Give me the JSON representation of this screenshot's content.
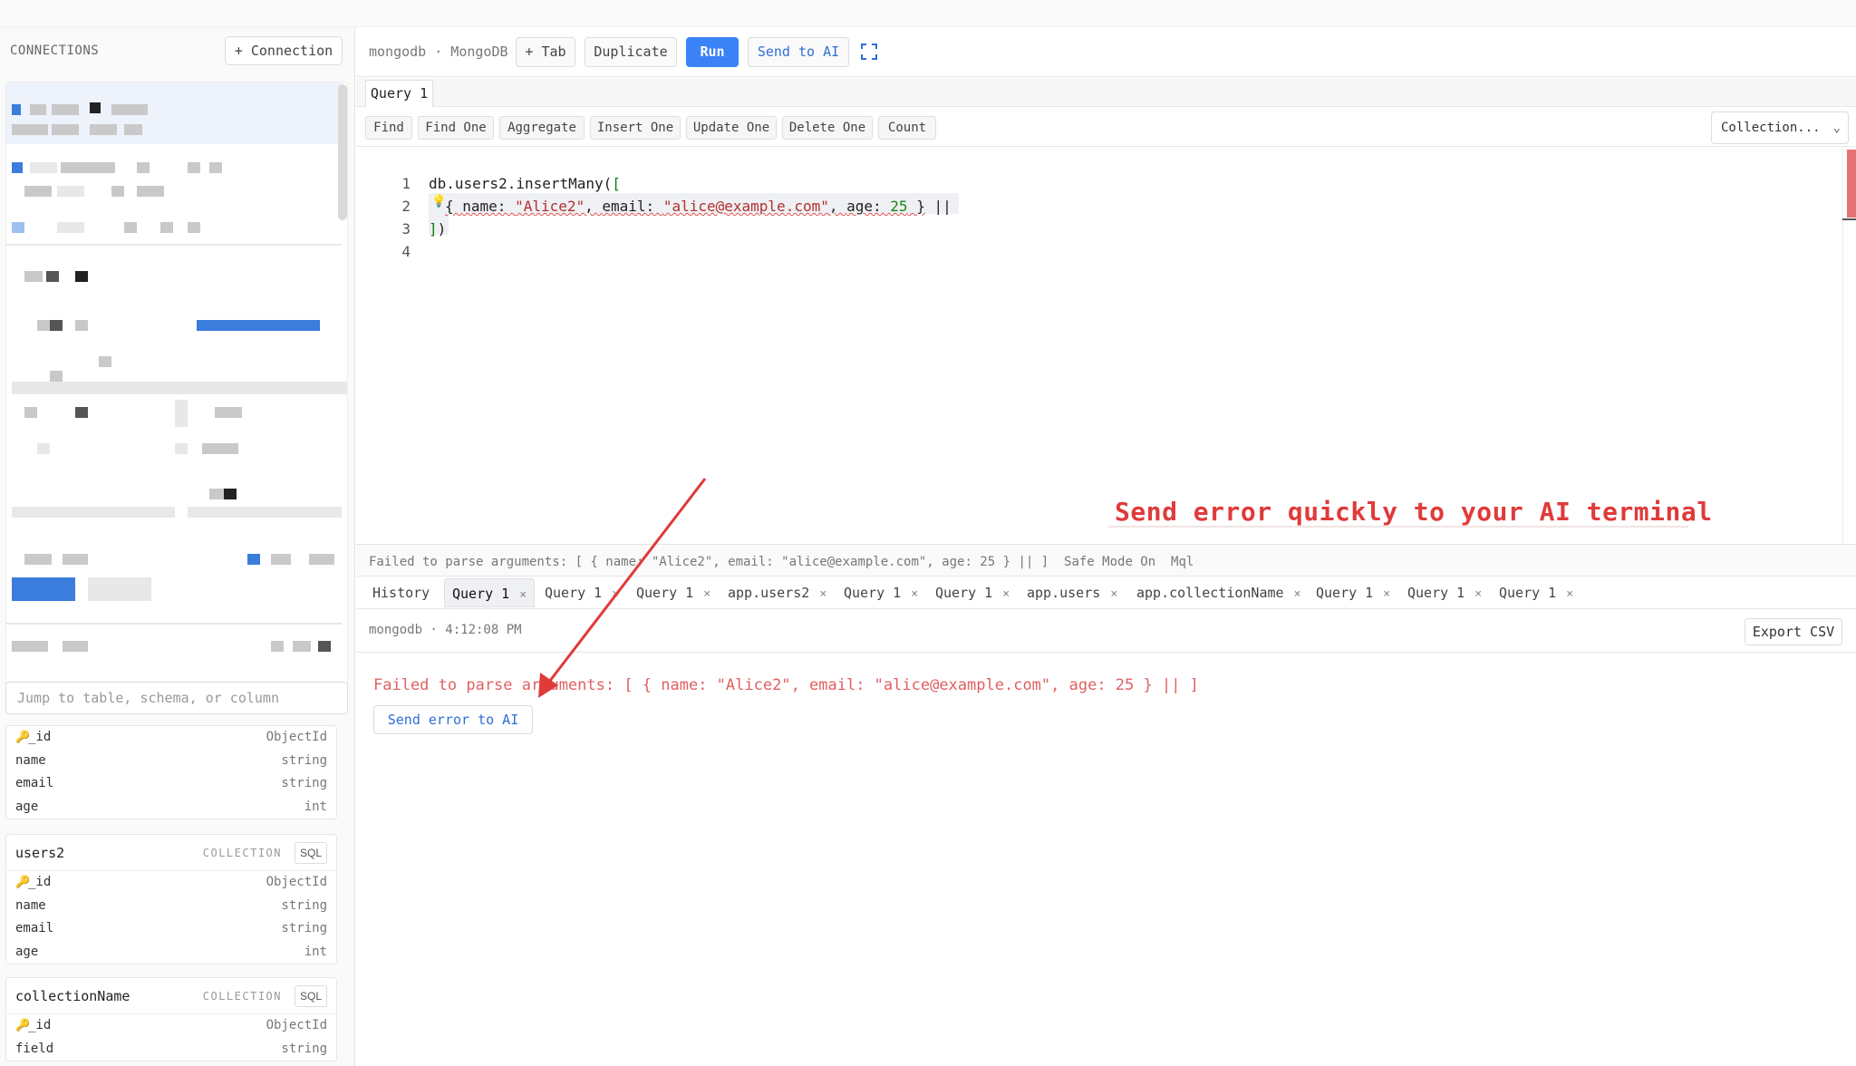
{
  "sidebar": {
    "title": "CONNECTIONS",
    "add_connection": "+ Connection",
    "search_placeholder": "Jump to table, schema, or column",
    "collections": [
      {
        "name": "",
        "fields": [
          {
            "name": "_id",
            "type": "ObjectId",
            "key": true
          },
          {
            "name": "name",
            "type": "string"
          },
          {
            "name": "email",
            "type": "string"
          },
          {
            "name": "age",
            "type": "int"
          }
        ]
      },
      {
        "name": "users2",
        "kind": "COLLECTION",
        "sql": "SQL",
        "fields": [
          {
            "name": "_id",
            "type": "ObjectId",
            "key": true
          },
          {
            "name": "name",
            "type": "string"
          },
          {
            "name": "email",
            "type": "string"
          },
          {
            "name": "age",
            "type": "int"
          }
        ]
      },
      {
        "name": "collectionName",
        "kind": "COLLECTION",
        "sql": "SQL",
        "fields": [
          {
            "name": "_id",
            "type": "ObjectId",
            "key": true
          },
          {
            "name": "field",
            "type": "string"
          }
        ]
      }
    ]
  },
  "toolbar": {
    "connection_label": "mongodb · MongoDB",
    "tab": "+ Tab",
    "duplicate": "Duplicate",
    "run": "Run",
    "send_to_ai": "Send to AI",
    "expand_icon": "expand-icon"
  },
  "query_tab": "Query 1",
  "actions": [
    "Find",
    "Find One",
    "Aggregate",
    "Insert One",
    "Update One",
    "Delete One",
    "Count"
  ],
  "collection_select": "Collection...",
  "editor": {
    "line_numbers": [
      "1",
      "2",
      "3",
      "4"
    ],
    "line1": "db.users2.insertMany(",
    "line1_bracket": "[",
    "line2_open": "{ ",
    "line2_k1": "name: ",
    "line2_v1": "\"Alice2\"",
    "line2_sep1": ", ",
    "line2_k2": "email: ",
    "line2_v2": "\"alice@example.com\"",
    "line2_sep2": ", ",
    "line2_k3": "age: ",
    "line2_v3": "25",
    "line2_close": " }",
    "line2_tail": " ||",
    "line3_bracket": "]",
    "line3_paren": ")"
  },
  "annotation": "Send error quickly to your AI terminal",
  "status": "Failed to parse arguments: [ { name: \"Alice2\", email: \"alice@example.com\", age: 25 } || ]  Safe Mode On  Mql",
  "result_tabs": [
    {
      "label": "History",
      "closable": false
    },
    {
      "label": "Query 1",
      "closable": true,
      "active": true
    },
    {
      "label": "Query 1",
      "closable": true
    },
    {
      "label": "Query 1",
      "closable": true
    },
    {
      "label": "app.users2",
      "closable": true
    },
    {
      "label": "Query 1",
      "closable": true
    },
    {
      "label": "Query 1",
      "closable": true
    },
    {
      "label": "app.users",
      "closable": true
    },
    {
      "label": "app.collectionName",
      "closable": true
    },
    {
      "label": "Query 1",
      "closable": true
    },
    {
      "label": "Query 1",
      "closable": true
    },
    {
      "label": "Query 1",
      "closable": true
    }
  ],
  "close_glyph": "×",
  "result": {
    "info": "mongodb · 4:12:08 PM",
    "export": "Export CSV",
    "error": "Failed to parse arguments: [ { name: \"Alice2\", email: \"alice@example.com\", age: 25 } || ]",
    "send_error": "Send error to AI"
  },
  "colors": {
    "accent": "#3b82f6",
    "error": "#e06060",
    "annotation": "#e03a3a"
  }
}
